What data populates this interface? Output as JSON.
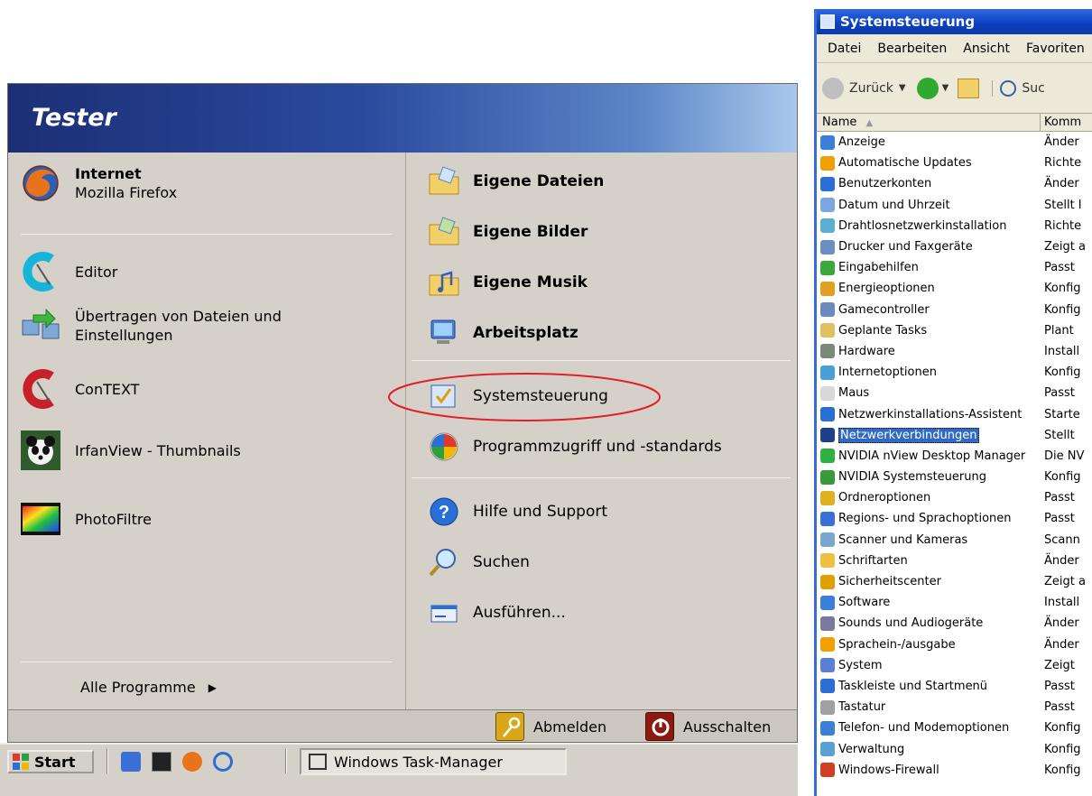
{
  "start_menu": {
    "user": "Tester",
    "left_items": [
      {
        "title": "Internet",
        "subtitle": "Mozilla Firefox"
      },
      {
        "title": "Editor"
      },
      {
        "title": "Übertragen von Dateien und",
        "subtitle": "Einstellungen"
      },
      {
        "title": "ConTEXT"
      },
      {
        "title": "IrfanView - Thumbnails"
      },
      {
        "title": "PhotoFiltre"
      }
    ],
    "all_programs": "Alle Programme",
    "right_items": [
      "Eigene Dateien",
      "Eigene Bilder",
      "Eigene Musik",
      "Arbeitsplatz",
      "Systemsteuerung",
      "Programmzugriff und -standards",
      "Hilfe und Support",
      "Suchen",
      "Ausführen..."
    ],
    "logoff": "Abmelden",
    "shutdown": "Ausschalten"
  },
  "taskbar": {
    "start": "Start",
    "task": "Windows Task-Manager"
  },
  "control_panel": {
    "title": "Systemsteuerung",
    "menu": [
      "Datei",
      "Bearbeiten",
      "Ansicht",
      "Favoriten"
    ],
    "back": "Zurück",
    "search": "Suc",
    "col_name": "Name",
    "col_comment": "Komm",
    "items": [
      {
        "name": "Anzeige",
        "comment": "Änder"
      },
      {
        "name": "Automatische Updates",
        "comment": "Richte"
      },
      {
        "name": "Benutzerkonten",
        "comment": "Änder"
      },
      {
        "name": "Datum und Uhrzeit",
        "comment": "Stellt I"
      },
      {
        "name": "Drahtlosnetzwerkinstallation",
        "comment": "Richte"
      },
      {
        "name": "Drucker und Faxgeräte",
        "comment": "Zeigt a"
      },
      {
        "name": "Eingabehilfen",
        "comment": "Passt"
      },
      {
        "name": "Energieoptionen",
        "comment": "Konfig"
      },
      {
        "name": "Gamecontroller",
        "comment": "Konfig"
      },
      {
        "name": "Geplante Tasks",
        "comment": "Plant"
      },
      {
        "name": "Hardware",
        "comment": "Install"
      },
      {
        "name": "Internetoptionen",
        "comment": "Konfig"
      },
      {
        "name": "Maus",
        "comment": "Passt"
      },
      {
        "name": "Netzwerkinstallations-Assistent",
        "comment": "Starte"
      },
      {
        "name": "Netzwerkverbindungen",
        "comment": "Stellt"
      },
      {
        "name": "NVIDIA nView Desktop Manager",
        "comment": "Die NV"
      },
      {
        "name": "NVIDIA Systemsteuerung",
        "comment": "Konfig"
      },
      {
        "name": "Ordneroptionen",
        "comment": "Passt"
      },
      {
        "name": "Regions- und Sprachoptionen",
        "comment": "Passt"
      },
      {
        "name": "Scanner und Kameras",
        "comment": "Scann"
      },
      {
        "name": "Schriftarten",
        "comment": "Änder"
      },
      {
        "name": "Sicherheitscenter",
        "comment": "Zeigt a"
      },
      {
        "name": "Software",
        "comment": "Install"
      },
      {
        "name": "Sounds und Audiogeräte",
        "comment": "Änder"
      },
      {
        "name": "Sprachein-/ausgabe",
        "comment": "Änder"
      },
      {
        "name": "System",
        "comment": "Zeigt"
      },
      {
        "name": "Taskleiste und Startmenü",
        "comment": "Passt"
      },
      {
        "name": "Tastatur",
        "comment": "Passt"
      },
      {
        "name": "Telefon- und Modemoptionen",
        "comment": "Konfig"
      },
      {
        "name": "Verwaltung",
        "comment": "Konfig"
      },
      {
        "name": "Windows-Firewall",
        "comment": "Konfig"
      }
    ]
  }
}
